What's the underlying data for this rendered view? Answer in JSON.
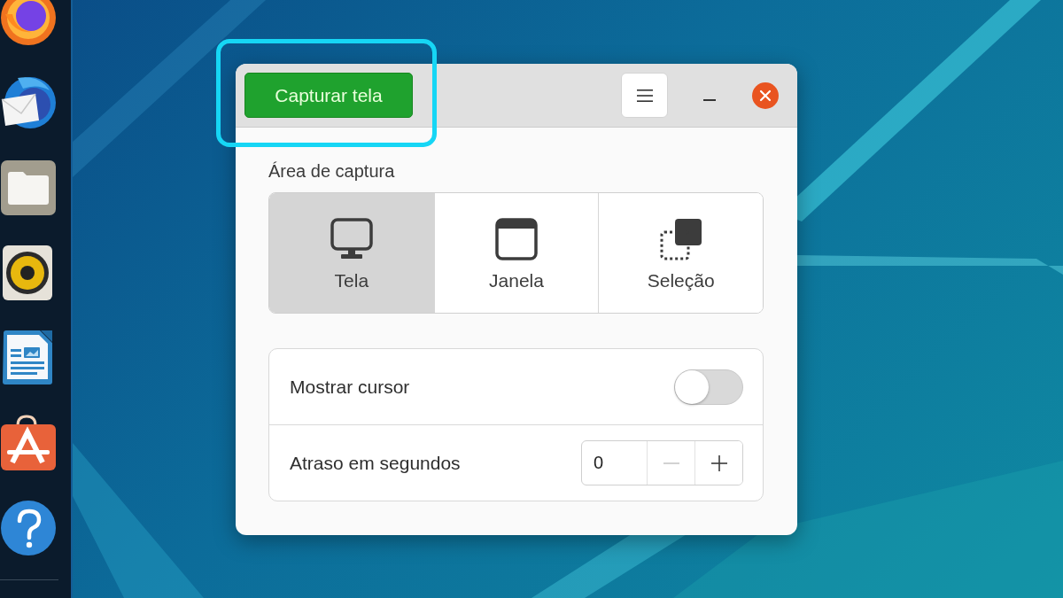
{
  "window": {
    "header": {
      "capture_button": "Capturar tela"
    },
    "capture_area": {
      "title": "Área de captura",
      "options": [
        {
          "kind": "screen",
          "label": "Tela",
          "selected": true
        },
        {
          "kind": "window",
          "label": "Janela",
          "selected": false
        },
        {
          "kind": "selection",
          "label": "Seleção",
          "selected": false
        }
      ]
    },
    "settings": [
      {
        "kind": "switch",
        "label": "Mostrar cursor",
        "on": false
      },
      {
        "kind": "spin",
        "label": "Atraso em segundos",
        "value": "0",
        "minus_disabled": true,
        "plus_disabled": false
      }
    ]
  }
}
